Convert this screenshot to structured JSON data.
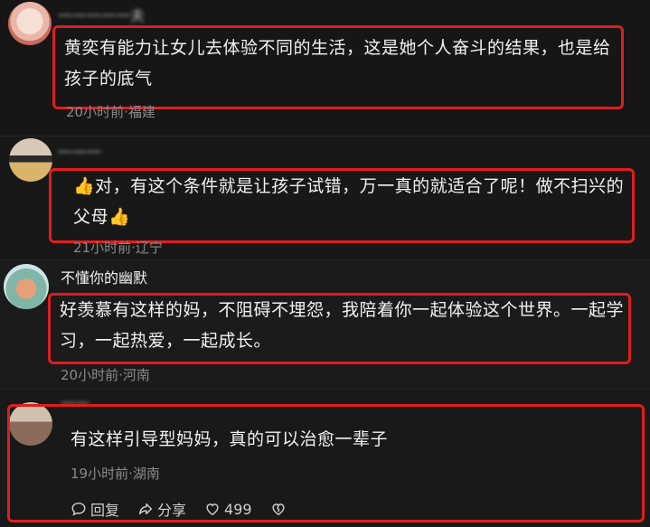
{
  "comments": [
    {
      "username": "一一一一一夫",
      "text": "黄奕有能力让女儿去体验不同的生活，这是她个人奋斗的结果，也是给孩子的底气",
      "meta": "20小时前·福建"
    },
    {
      "username": "一一一",
      "text_lead_icon": "👍",
      "text": "对，有这个条件就是让孩子试错，万一真的就适合了呢！做不扫兴的父母",
      "text_trail_icon": "👍",
      "meta": "21小时前·辽宁"
    },
    {
      "username": "不懂你的幽默",
      "text": "好羡慕有这样的妈，不阻碍不埋怨，我陪着你一起体验这个世界。一起学习，一起热爱，一起成长。",
      "meta": "20小时前·河南"
    },
    {
      "username": "一一",
      "text": "有这样引导型妈妈，真的可以治愈一辈子",
      "meta": "19小时前·湖南",
      "actions": {
        "reply_label": "回复",
        "share_label": "分享",
        "like_count": "499"
      }
    }
  ],
  "colors": {
    "highlight": "#e11d1d",
    "background": "#151515",
    "meta_text": "#8a8a8a"
  },
  "icons": {
    "reply": "speech-bubble-icon",
    "share": "share-arrow-icon",
    "like": "heart-icon",
    "dislike": "broken-heart-icon",
    "thumbs_up": "thumbs-up-emoji"
  }
}
